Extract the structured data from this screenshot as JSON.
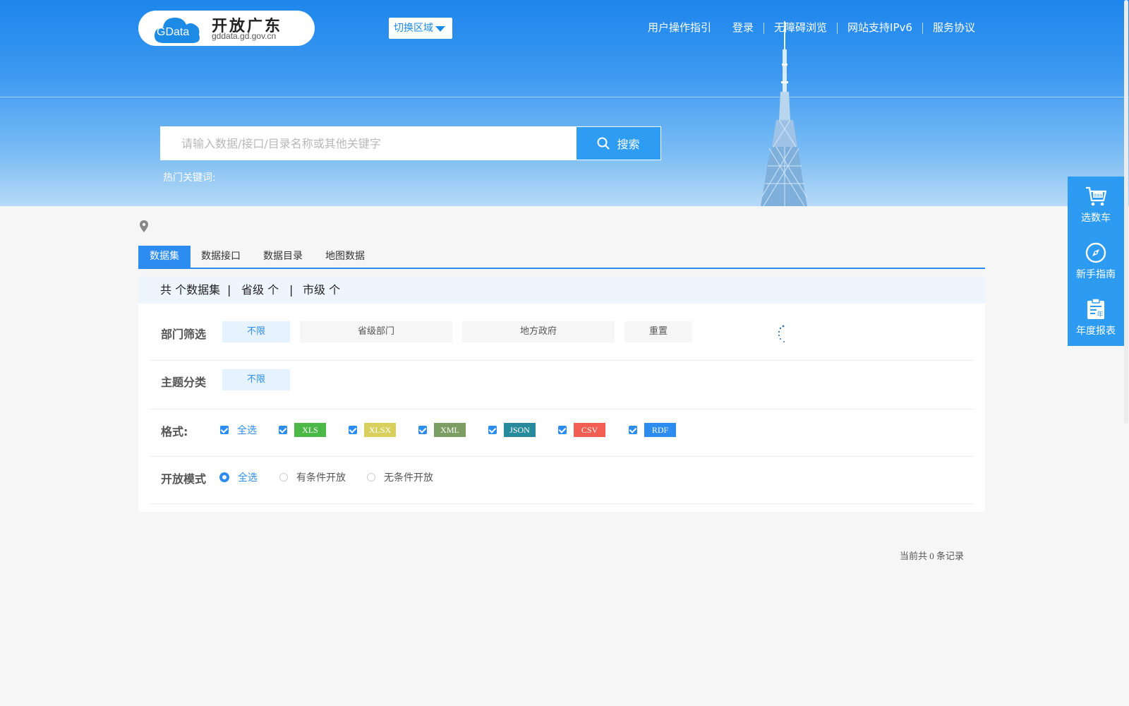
{
  "header": {
    "logo_text": "GData",
    "site_name": "开放广东",
    "site_domain": "gddata.gd.gov.cn",
    "region_switch": "切换区域",
    "nav": [
      "用户操作指引",
      "登录",
      "无障碍浏览",
      "网站支持IPv6",
      "服务协议"
    ]
  },
  "search": {
    "placeholder": "请输入数据/接口/目录名称或其他关键字",
    "value": "",
    "button": "搜索",
    "hot_keywords_label": "热门关键词:"
  },
  "side_float": {
    "items": [
      {
        "label": "选数车",
        "icon": "data-cart-icon"
      },
      {
        "label": "新手指南",
        "icon": "compass-icon"
      },
      {
        "label": "年度报表",
        "icon": "annual-report-icon"
      }
    ]
  },
  "tabs": [
    "数据集",
    "数据接口",
    "数据目录",
    "地图数据"
  ],
  "active_tab": "数据集",
  "summary": {
    "total": "共 个数据集",
    "province": "省级 个",
    "city": "市级 个",
    "separator": "|"
  },
  "filters": {
    "department": {
      "label": "部门筛选",
      "options": [
        "不限",
        "省级部门",
        "地方政府",
        "重置"
      ],
      "selected": "不限"
    },
    "topic": {
      "label": "主题分类",
      "options": [
        "不限"
      ],
      "selected": "不限"
    },
    "format": {
      "label": "格式:",
      "all_label": "全选",
      "formats": [
        {
          "name": "XLS",
          "color": "#4cb847"
        },
        {
          "name": "XLSX",
          "color": "#d9cf5d"
        },
        {
          "name": "XML",
          "color": "#7c9e63"
        },
        {
          "name": "JSON",
          "color": "#27899c"
        },
        {
          "name": "CSV",
          "color": "#f25e52"
        },
        {
          "name": "RDF",
          "color": "#2d8cf0"
        }
      ]
    },
    "open_mode": {
      "label": "开放模式",
      "options": [
        "全选",
        "有条件开放",
        "无条件开放"
      ],
      "selected": "全选"
    }
  },
  "records": "当前共 0 条记录",
  "colors": {
    "primary": "#2d8cf0",
    "float_bg": "#2d9bf2"
  }
}
